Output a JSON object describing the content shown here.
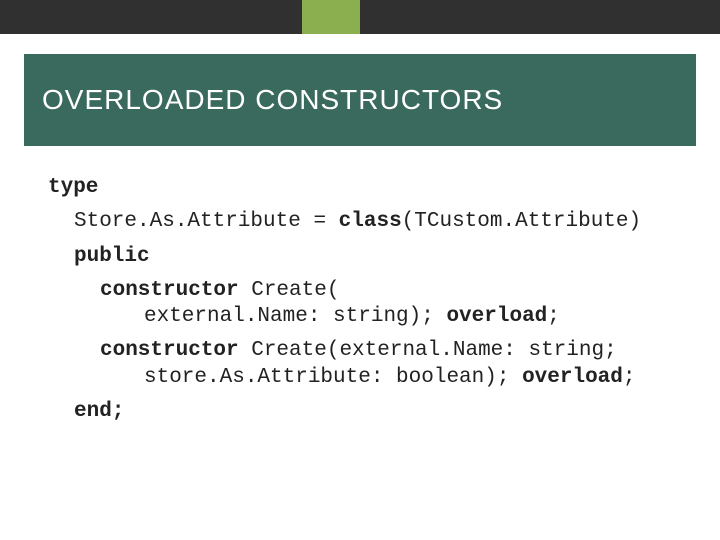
{
  "title": "OVERLOADED CONSTRUCTORS",
  "code": {
    "l0": "type",
    "l1a": "Store.As.Attribute = ",
    "l1b": "class",
    "l1c": "(TCustom.Attribute)",
    "l2": "public",
    "l3a": "constructor",
    "l3b": " Create(",
    "l4a": "external.Name: string); ",
    "l4b": "overload",
    "l4c": ";",
    "l5a": "constructor",
    "l5b": " Create(external.Name: string;",
    "l6a": "store.As.Attribute: boolean); ",
    "l6b": "overload",
    "l6c": ";",
    "l7": "end;"
  }
}
